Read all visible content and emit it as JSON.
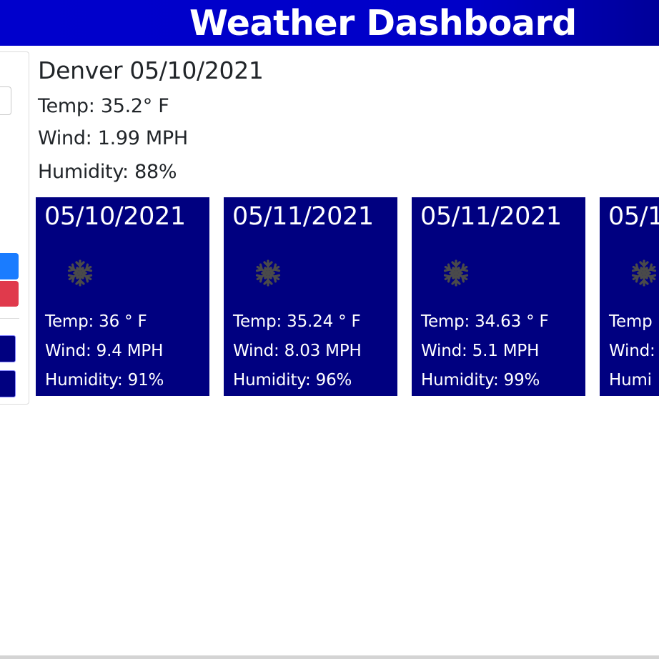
{
  "header": {
    "title": "Weather Dashboard"
  },
  "sidebar": {
    "search_input_value": "",
    "history": [
      "",
      ""
    ]
  },
  "current": {
    "title": "Denver 05/10/2021",
    "temp": "Temp: 35.2° F",
    "wind": "Wind: 1.99 MPH",
    "humidity": "Humidity: 88%"
  },
  "forecast": [
    {
      "date": "05/10/2021",
      "icon": "snowflake-icon",
      "temp": "Temp: 36 ° F",
      "wind": "Wind: 9.4 MPH",
      "humidity": "Humidity: 91%"
    },
    {
      "date": "05/11/2021",
      "icon": "snowflake-icon",
      "temp": "Temp: 35.24 ° F",
      "wind": "Wind: 8.03 MPH",
      "humidity": "Humidity: 96%"
    },
    {
      "date": "05/11/2021",
      "icon": "snowflake-icon",
      "temp": "Temp: 34.63 ° F",
      "wind": "Wind: 5.1 MPH",
      "humidity": "Humidity: 99%"
    },
    {
      "date": "05/1",
      "icon": "snowflake-icon",
      "temp": "Temp",
      "wind": "Wind:",
      "humidity": "Humi"
    }
  ],
  "colors": {
    "header_bg": "#0000cc",
    "card_bg": "#000080",
    "search_button": "#1a7cff",
    "clear_button": "#e03a4c",
    "icon_gray": "#4a4a4a"
  }
}
